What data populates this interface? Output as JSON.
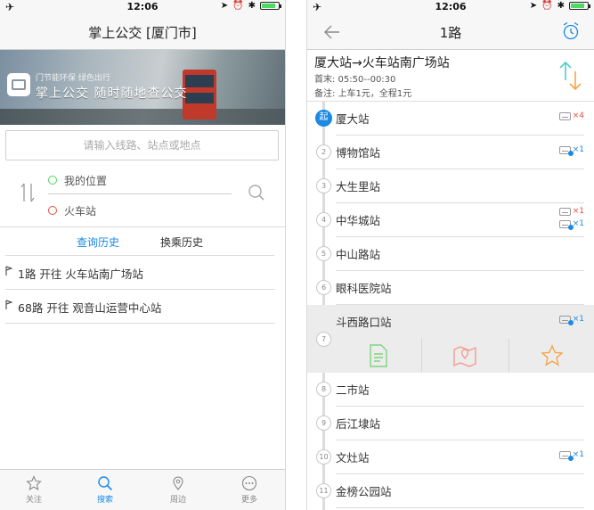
{
  "left": {
    "status": {
      "time": "12:06"
    },
    "nav_title": "掌上公交 [厦门市]",
    "banner": {
      "tagline": "门节能环保 绿色出行",
      "slogan": "掌上公交  随时随地查公交"
    },
    "search_placeholder": "请输入线路、站点或地点",
    "route": {
      "from": "我的位置",
      "to": "火车站",
      "from_color": "#4cd964",
      "to_color": "#e74c3c"
    },
    "history_tabs": [
      {
        "label": "查询历史",
        "active": true
      },
      {
        "label": "换乘历史",
        "active": false
      }
    ],
    "history": [
      {
        "text": "1路 开往 火车站南广场站"
      },
      {
        "text": "68路 开往 观音山运营中心站"
      }
    ],
    "tabbar": [
      {
        "label": "关注",
        "icon": "star-icon",
        "active": false
      },
      {
        "label": "搜索",
        "icon": "search-icon",
        "active": true
      },
      {
        "label": "周边",
        "icon": "location-pin-icon",
        "active": false
      },
      {
        "label": "更多",
        "icon": "more-icon",
        "active": false
      }
    ]
  },
  "right": {
    "status": {
      "time": "12:06"
    },
    "nav_title": "1路",
    "line": {
      "name": "厦大站→火车站南广场站",
      "first_time": "首末: 05:50--00:30",
      "fare": "备注: 上车1元，全程1元"
    },
    "stops": [
      {
        "num": "起",
        "name": "厦大站",
        "buses": [
          {
            "count": "×4",
            "color": "red"
          }
        ]
      },
      {
        "num": "2",
        "name": "博物馆站",
        "buses": [
          {
            "count": "×1",
            "color": "blue"
          }
        ]
      },
      {
        "num": "3",
        "name": "大生里站",
        "buses": []
      },
      {
        "num": "4",
        "name": "中华城站",
        "buses": [
          {
            "count": "×1",
            "color": "red"
          },
          {
            "count": "×1",
            "color": "blue"
          }
        ]
      },
      {
        "num": "5",
        "name": "中山路站",
        "buses": []
      },
      {
        "num": "6",
        "name": "眼科医院站",
        "buses": []
      },
      {
        "num": "7",
        "name": "斗西路口站",
        "buses": [
          {
            "count": "×1",
            "color": "blue"
          }
        ],
        "expanded": true
      },
      {
        "num": "8",
        "name": "二市站",
        "buses": []
      },
      {
        "num": "9",
        "name": "后江埭站",
        "buses": []
      },
      {
        "num": "10",
        "name": "文灶站",
        "buses": [
          {
            "count": "×1",
            "color": "blue"
          }
        ]
      },
      {
        "num": "11",
        "name": "金榜公园站",
        "buses": []
      }
    ],
    "colors": {
      "accent": "#1a8ae5",
      "green_icon": "#7ed47e",
      "orange_icon": "#f5a54a",
      "reverse_teal": "#4dd0c8"
    }
  }
}
